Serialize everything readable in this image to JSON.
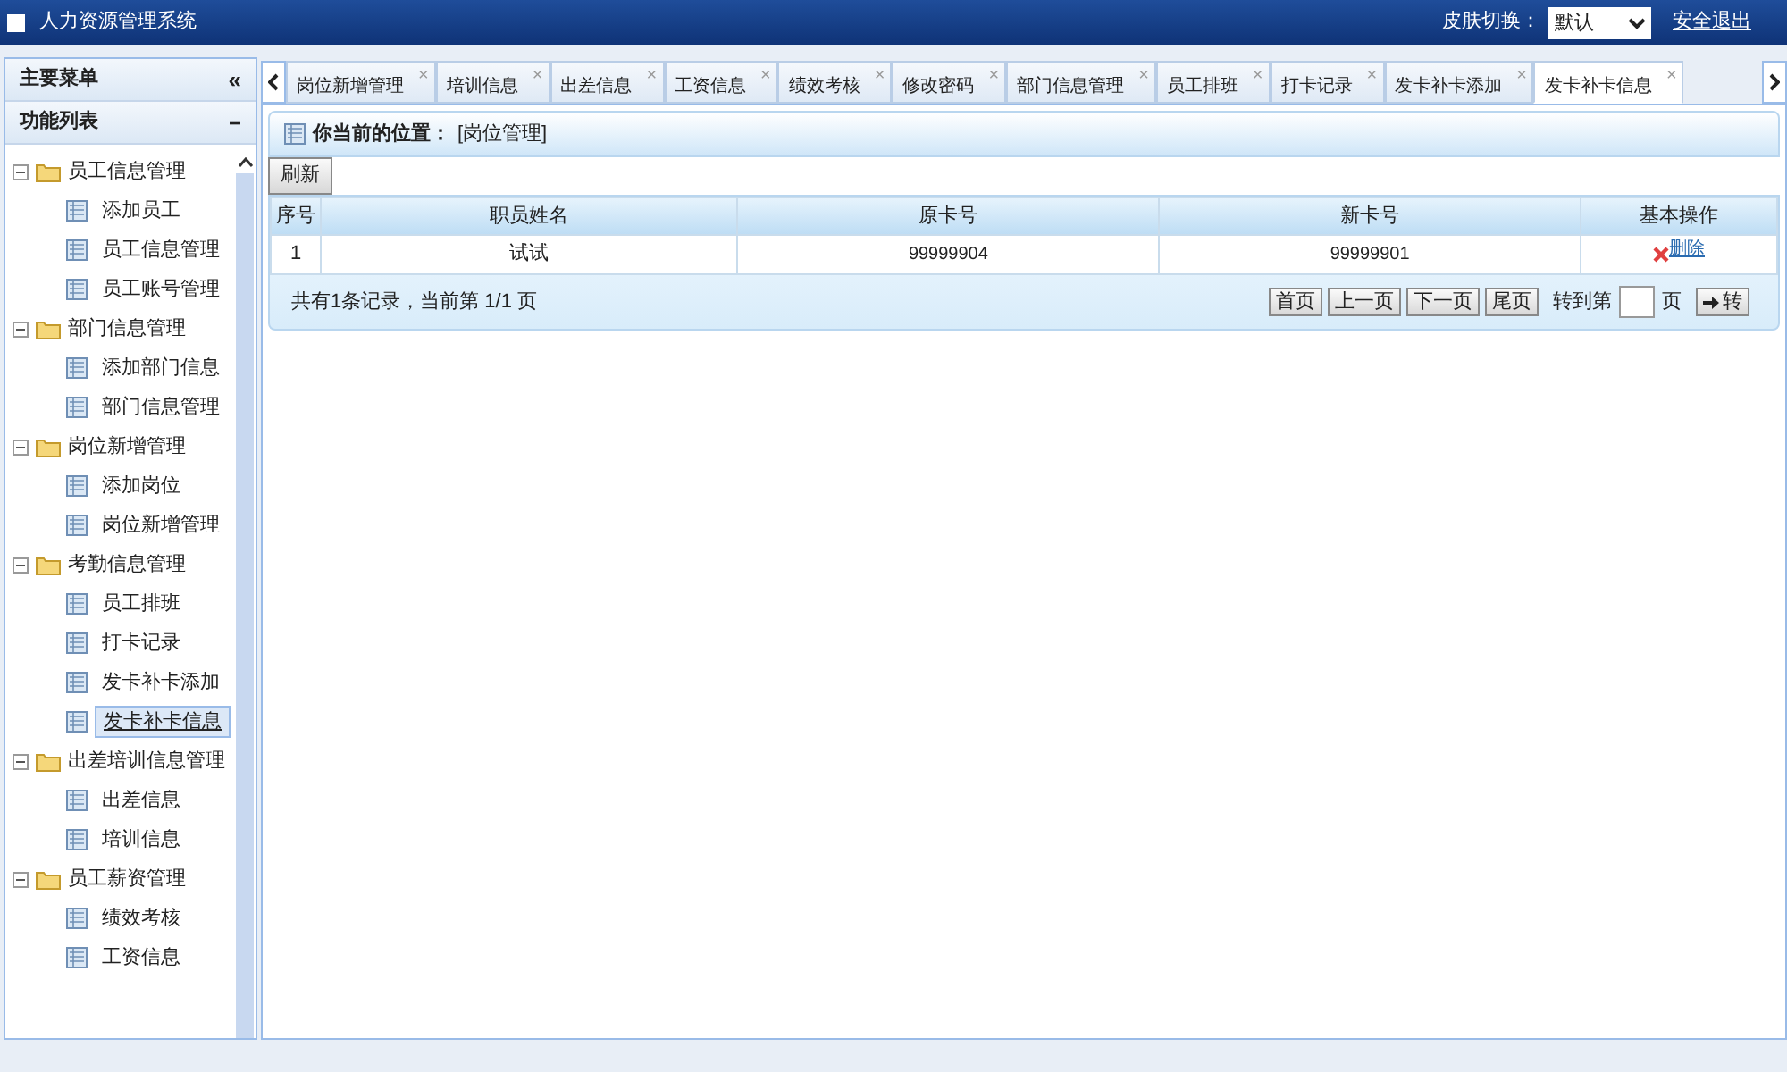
{
  "header": {
    "title": "人力资源管理系统",
    "skin_label": "皮肤切换：",
    "skin_value": "默认",
    "logout": "安全退出"
  },
  "sidebar": {
    "title": "主要菜单",
    "collapse": "«",
    "section": "功能列表",
    "section_toggle": "−",
    "tree": [
      {
        "label": "员工信息管理",
        "expanded": true,
        "children": [
          {
            "label": "添加员工",
            "selected": false
          },
          {
            "label": "员工信息管理",
            "selected": false
          },
          {
            "label": "员工账号管理",
            "selected": false
          }
        ]
      },
      {
        "label": "部门信息管理",
        "expanded": true,
        "children": [
          {
            "label": "添加部门信息",
            "selected": false
          },
          {
            "label": "部门信息管理",
            "selected": false
          }
        ]
      },
      {
        "label": "岗位新增管理",
        "expanded": true,
        "children": [
          {
            "label": "添加岗位",
            "selected": false
          },
          {
            "label": "岗位新增管理",
            "selected": false
          }
        ]
      },
      {
        "label": "考勤信息管理",
        "expanded": true,
        "children": [
          {
            "label": "员工排班",
            "selected": false
          },
          {
            "label": "打卡记录",
            "selected": false
          },
          {
            "label": "发卡补卡添加",
            "selected": false
          },
          {
            "label": "发卡补卡信息",
            "selected": true
          }
        ]
      },
      {
        "label": "出差培训信息管理",
        "expanded": true,
        "children": [
          {
            "label": "出差信息",
            "selected": false
          },
          {
            "label": "培训信息",
            "selected": false
          }
        ]
      },
      {
        "label": "员工薪资管理",
        "expanded": true,
        "children": [
          {
            "label": "绩效考核",
            "selected": false
          },
          {
            "label": "工资信息",
            "selected": false
          }
        ]
      }
    ]
  },
  "tabs": [
    {
      "label": "岗位新增管理",
      "selected": false
    },
    {
      "label": "培训信息",
      "selected": false
    },
    {
      "label": "出差信息",
      "selected": false
    },
    {
      "label": "工资信息",
      "selected": false
    },
    {
      "label": "绩效考核",
      "selected": false
    },
    {
      "label": "修改密码",
      "selected": false
    },
    {
      "label": "部门信息管理",
      "selected": false
    },
    {
      "label": "员工排班",
      "selected": false
    },
    {
      "label": "打卡记录",
      "selected": false
    },
    {
      "label": "发卡补卡添加",
      "selected": false
    },
    {
      "label": "发卡补卡信息",
      "selected": true
    }
  ],
  "tab_close": "×",
  "breadcrumb": {
    "label": "你当前的位置：",
    "value": "[岗位管理]"
  },
  "refresh": "刷新",
  "table": {
    "columns": [
      "序号",
      "职员姓名",
      "原卡号",
      "新卡号",
      "基本操作"
    ],
    "rows": [
      {
        "cells": [
          "1",
          "试试",
          "99999904",
          "99999901"
        ],
        "action": "删除"
      }
    ]
  },
  "pager": {
    "summary": "共有1条记录，当前第 1/1 页",
    "buttons": [
      "首页",
      "上一页",
      "下一页",
      "尾页"
    ],
    "goto_label": "转到第",
    "page_label": "页",
    "go": "转"
  }
}
